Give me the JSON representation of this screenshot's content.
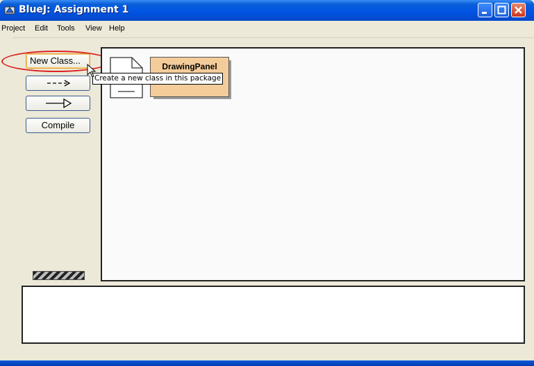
{
  "window": {
    "title": "BlueJ:  Assignment 1",
    "icon": "bluej-app-icon",
    "controls": [
      "minimize-icon",
      "maximize-icon",
      "close-icon"
    ]
  },
  "menubar": {
    "items": [
      "Project",
      "Edit",
      "Tools",
      "View",
      "Help"
    ]
  },
  "toolbar": {
    "new_class_label": "New Class...",
    "uses_arrow_label": "--->",
    "inherits_arrow_label": "——▷",
    "compile_label": "Compile"
  },
  "tooltip": {
    "text": "Create a new class in this package"
  },
  "diagram": {
    "classes": [
      {
        "name": "DrawingPanel",
        "color": "#f4cc9a"
      }
    ],
    "package_icon": "document-icon"
  },
  "colors": {
    "titlebar": "#0054e3",
    "class_fill": "#f4cc9a",
    "highlight": "#dd2222"
  }
}
